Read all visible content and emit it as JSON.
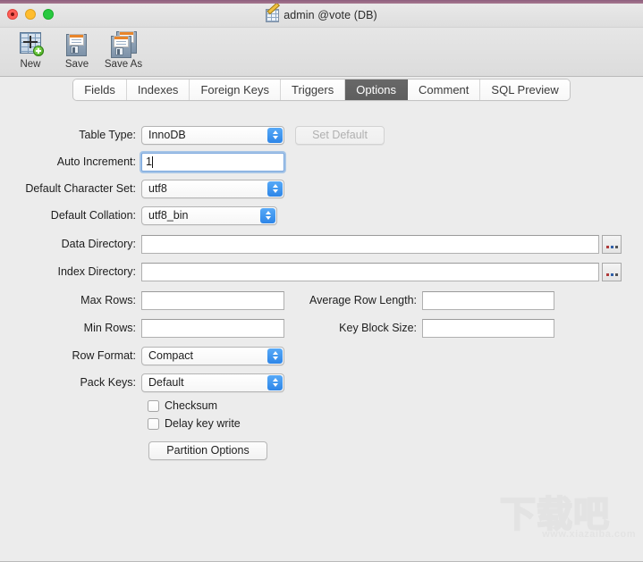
{
  "window": {
    "title": "admin @vote (DB)",
    "title_icon": "table-edit-icon",
    "controls": {
      "close": "close-button",
      "minimize": "minimize-button",
      "maximize": "maximize-button"
    }
  },
  "toolbar": {
    "items": [
      {
        "label": "New",
        "icon": "new-table-icon"
      },
      {
        "label": "Save",
        "icon": "save-floppy-icon"
      },
      {
        "label": "Save As",
        "icon": "save-as-floppy-icon"
      }
    ]
  },
  "tabs": [
    {
      "label": "Fields",
      "active": false
    },
    {
      "label": "Indexes",
      "active": false
    },
    {
      "label": "Foreign Keys",
      "active": false
    },
    {
      "label": "Triggers",
      "active": false
    },
    {
      "label": "Options",
      "active": true
    },
    {
      "label": "Comment",
      "active": false
    },
    {
      "label": "SQL Preview",
      "active": false
    }
  ],
  "options_form": {
    "table_type": {
      "label": "Table Type:",
      "value": "InnoDB"
    },
    "set_default": {
      "label": "Set Default",
      "disabled": true
    },
    "auto_increment": {
      "label": "Auto Increment:",
      "value": "1",
      "focused": true
    },
    "default_charset": {
      "label": "Default Character Set:",
      "value": "utf8"
    },
    "default_collation": {
      "label": "Default Collation:",
      "value": "utf8_bin"
    },
    "data_directory": {
      "label": "Data Directory:",
      "value": "",
      "browse": "..."
    },
    "index_directory": {
      "label": "Index Directory:",
      "value": "",
      "browse": "..."
    },
    "max_rows": {
      "label": "Max Rows:",
      "value": ""
    },
    "avg_row_length": {
      "label": "Average Row Length:",
      "value": ""
    },
    "min_rows": {
      "label": "Min Rows:",
      "value": ""
    },
    "key_block_size": {
      "label": "Key Block Size:",
      "value": ""
    },
    "row_format": {
      "label": "Row Format:",
      "value": "Compact"
    },
    "pack_keys": {
      "label": "Pack Keys:",
      "value": "Default"
    },
    "checksum": {
      "label": "Checksum",
      "checked": false
    },
    "delay_key_write": {
      "label": "Delay key write",
      "checked": false
    },
    "partition_options": {
      "label": "Partition Options"
    }
  },
  "watermark": {
    "text": "下载吧",
    "url": "www.xiazaiba.com"
  },
  "colors": {
    "accent_blue": "#2e86e8",
    "active_tab_bg": "#5e5e5e",
    "window_bg": "#ececec",
    "focus_ring": "#7aa7de"
  }
}
